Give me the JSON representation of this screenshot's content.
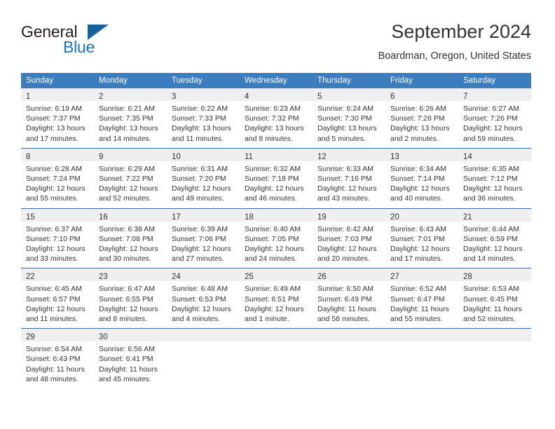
{
  "brand": {
    "name_part1": "General",
    "name_part2": "Blue",
    "triangle_color": "#14639f",
    "blue_color": "#1874bb"
  },
  "header": {
    "month_title": "September 2024",
    "location": "Boardman, Oregon, United States",
    "header_bg_color": "#3c7dc0"
  },
  "weekday_headers": [
    "Sunday",
    "Monday",
    "Tuesday",
    "Wednesday",
    "Thursday",
    "Friday",
    "Saturday"
  ],
  "weeks": [
    [
      {
        "day": "1",
        "sunrise": "Sunrise: 6:19 AM",
        "sunset": "Sunset: 7:37 PM",
        "daylight": "Daylight: 13 hours and 17 minutes."
      },
      {
        "day": "2",
        "sunrise": "Sunrise: 6:21 AM",
        "sunset": "Sunset: 7:35 PM",
        "daylight": "Daylight: 13 hours and 14 minutes."
      },
      {
        "day": "3",
        "sunrise": "Sunrise: 6:22 AM",
        "sunset": "Sunset: 7:33 PM",
        "daylight": "Daylight: 13 hours and 11 minutes."
      },
      {
        "day": "4",
        "sunrise": "Sunrise: 6:23 AM",
        "sunset": "Sunset: 7:32 PM",
        "daylight": "Daylight: 13 hours and 8 minutes."
      },
      {
        "day": "5",
        "sunrise": "Sunrise: 6:24 AM",
        "sunset": "Sunset: 7:30 PM",
        "daylight": "Daylight: 13 hours and 5 minutes."
      },
      {
        "day": "6",
        "sunrise": "Sunrise: 6:26 AM",
        "sunset": "Sunset: 7:28 PM",
        "daylight": "Daylight: 13 hours and 2 minutes."
      },
      {
        "day": "7",
        "sunrise": "Sunrise: 6:27 AM",
        "sunset": "Sunset: 7:26 PM",
        "daylight": "Daylight: 12 hours and 59 minutes."
      }
    ],
    [
      {
        "day": "8",
        "sunrise": "Sunrise: 6:28 AM",
        "sunset": "Sunset: 7:24 PM",
        "daylight": "Daylight: 12 hours and 55 minutes."
      },
      {
        "day": "9",
        "sunrise": "Sunrise: 6:29 AM",
        "sunset": "Sunset: 7:22 PM",
        "daylight": "Daylight: 12 hours and 52 minutes."
      },
      {
        "day": "10",
        "sunrise": "Sunrise: 6:31 AM",
        "sunset": "Sunset: 7:20 PM",
        "daylight": "Daylight: 12 hours and 49 minutes."
      },
      {
        "day": "11",
        "sunrise": "Sunrise: 6:32 AM",
        "sunset": "Sunset: 7:18 PM",
        "daylight": "Daylight: 12 hours and 46 minutes."
      },
      {
        "day": "12",
        "sunrise": "Sunrise: 6:33 AM",
        "sunset": "Sunset: 7:16 PM",
        "daylight": "Daylight: 12 hours and 43 minutes."
      },
      {
        "day": "13",
        "sunrise": "Sunrise: 6:34 AM",
        "sunset": "Sunset: 7:14 PM",
        "daylight": "Daylight: 12 hours and 40 minutes."
      },
      {
        "day": "14",
        "sunrise": "Sunrise: 6:35 AM",
        "sunset": "Sunset: 7:12 PM",
        "daylight": "Daylight: 12 hours and 36 minutes."
      }
    ],
    [
      {
        "day": "15",
        "sunrise": "Sunrise: 6:37 AM",
        "sunset": "Sunset: 7:10 PM",
        "daylight": "Daylight: 12 hours and 33 minutes."
      },
      {
        "day": "16",
        "sunrise": "Sunrise: 6:38 AM",
        "sunset": "Sunset: 7:08 PM",
        "daylight": "Daylight: 12 hours and 30 minutes."
      },
      {
        "day": "17",
        "sunrise": "Sunrise: 6:39 AM",
        "sunset": "Sunset: 7:06 PM",
        "daylight": "Daylight: 12 hours and 27 minutes."
      },
      {
        "day": "18",
        "sunrise": "Sunrise: 6:40 AM",
        "sunset": "Sunset: 7:05 PM",
        "daylight": "Daylight: 12 hours and 24 minutes."
      },
      {
        "day": "19",
        "sunrise": "Sunrise: 6:42 AM",
        "sunset": "Sunset: 7:03 PM",
        "daylight": "Daylight: 12 hours and 20 minutes."
      },
      {
        "day": "20",
        "sunrise": "Sunrise: 6:43 AM",
        "sunset": "Sunset: 7:01 PM",
        "daylight": "Daylight: 12 hours and 17 minutes."
      },
      {
        "day": "21",
        "sunrise": "Sunrise: 6:44 AM",
        "sunset": "Sunset: 6:59 PM",
        "daylight": "Daylight: 12 hours and 14 minutes."
      }
    ],
    [
      {
        "day": "22",
        "sunrise": "Sunrise: 6:45 AM",
        "sunset": "Sunset: 6:57 PM",
        "daylight": "Daylight: 12 hours and 11 minutes."
      },
      {
        "day": "23",
        "sunrise": "Sunrise: 6:47 AM",
        "sunset": "Sunset: 6:55 PM",
        "daylight": "Daylight: 12 hours and 8 minutes."
      },
      {
        "day": "24",
        "sunrise": "Sunrise: 6:48 AM",
        "sunset": "Sunset: 6:53 PM",
        "daylight": "Daylight: 12 hours and 4 minutes."
      },
      {
        "day": "25",
        "sunrise": "Sunrise: 6:49 AM",
        "sunset": "Sunset: 6:51 PM",
        "daylight": "Daylight: 12 hours and 1 minute."
      },
      {
        "day": "26",
        "sunrise": "Sunrise: 6:50 AM",
        "sunset": "Sunset: 6:49 PM",
        "daylight": "Daylight: 11 hours and 58 minutes."
      },
      {
        "day": "27",
        "sunrise": "Sunrise: 6:52 AM",
        "sunset": "Sunset: 6:47 PM",
        "daylight": "Daylight: 11 hours and 55 minutes."
      },
      {
        "day": "28",
        "sunrise": "Sunrise: 6:53 AM",
        "sunset": "Sunset: 6:45 PM",
        "daylight": "Daylight: 11 hours and 52 minutes."
      }
    ],
    [
      {
        "day": "29",
        "sunrise": "Sunrise: 6:54 AM",
        "sunset": "Sunset: 6:43 PM",
        "daylight": "Daylight: 11 hours and 48 minutes."
      },
      {
        "day": "30",
        "sunrise": "Sunrise: 6:56 AM",
        "sunset": "Sunset: 6:41 PM",
        "daylight": "Daylight: 11 hours and 45 minutes."
      },
      {
        "day": "",
        "sunrise": "",
        "sunset": "",
        "daylight": ""
      },
      {
        "day": "",
        "sunrise": "",
        "sunset": "",
        "daylight": ""
      },
      {
        "day": "",
        "sunrise": "",
        "sunset": "",
        "daylight": ""
      },
      {
        "day": "",
        "sunrise": "",
        "sunset": "",
        "daylight": ""
      },
      {
        "day": "",
        "sunrise": "",
        "sunset": "",
        "daylight": ""
      }
    ]
  ]
}
